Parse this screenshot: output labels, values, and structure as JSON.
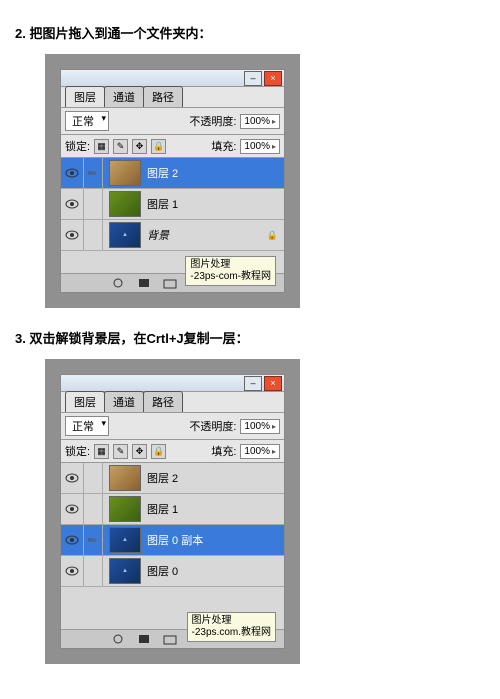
{
  "step2": "2. 把图片拖入到通一个文件夹内：",
  "step3": "3. 双击解锁背景层，在Crtl+J复制一层：",
  "panel1": {
    "tabs": [
      "图层",
      "通道",
      "路径"
    ],
    "blend": "正常",
    "opacityLabel": "不透明度:",
    "opacityVal": "100%",
    "lockLabel": "锁定:",
    "fillLabel": "填充:",
    "fillVal": "100%",
    "layers": [
      {
        "name": "图层 2",
        "thumb": "warm",
        "sel": true
      },
      {
        "name": "图层 1",
        "thumb": "green",
        "sel": false
      },
      {
        "name": "背景",
        "thumb": "blue",
        "sel": false,
        "bg": true,
        "locked": true
      }
    ],
    "tip1": "图片处理",
    "tip2": "-23ps-com-教程网"
  },
  "panel2": {
    "tabs": [
      "图层",
      "通道",
      "路径"
    ],
    "blend": "正常",
    "opacityLabel": "不透明度:",
    "opacityVal": "100%",
    "lockLabel": "锁定:",
    "fillLabel": "填充:",
    "fillVal": "100%",
    "layers": [
      {
        "name": "图层 2",
        "thumb": "warm",
        "sel": false
      },
      {
        "name": "图层 1",
        "thumb": "green",
        "sel": false
      },
      {
        "name": "图层 0 副本",
        "thumb": "blue",
        "sel": true
      },
      {
        "name": "图层 0",
        "thumb": "blue",
        "sel": false
      }
    ],
    "tip1": "图片处理",
    "tip2": "-23ps.com.教程网"
  }
}
